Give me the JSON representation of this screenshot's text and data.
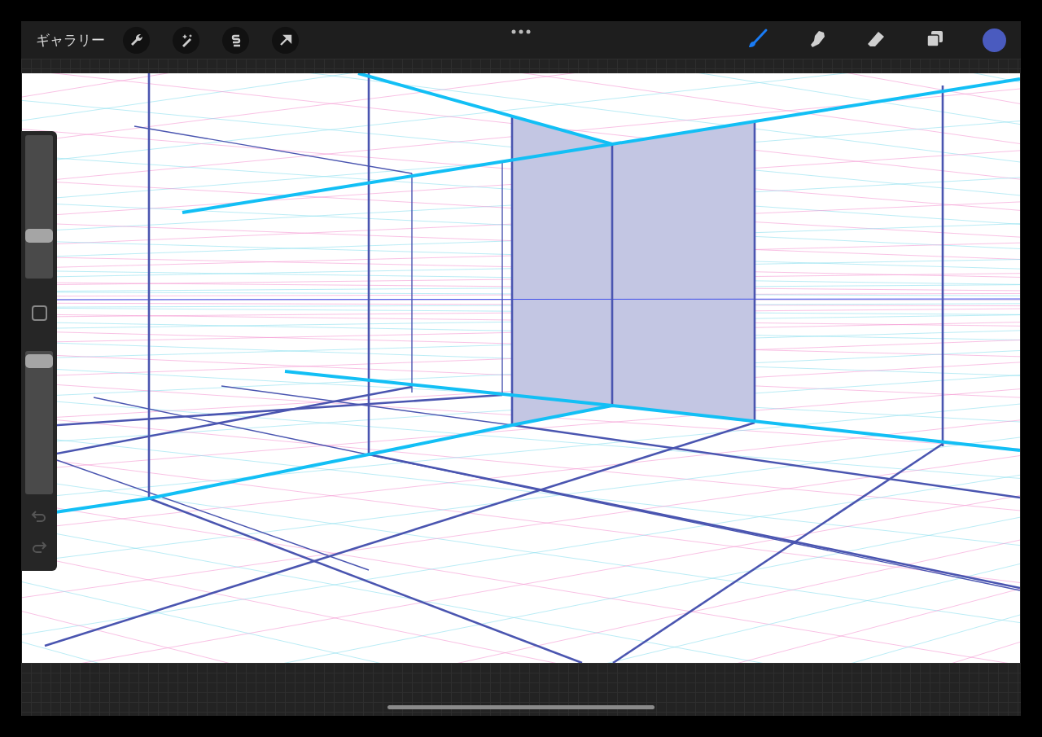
{
  "toolbar": {
    "gallery_label": "ギャラリー",
    "actions": [
      {
        "kind": "wrench"
      },
      {
        "kind": "wand"
      },
      {
        "kind": "selection"
      },
      {
        "kind": "transform"
      }
    ],
    "tools": [
      {
        "kind": "brush",
        "selected": true
      },
      {
        "kind": "smudge",
        "selected": false
      },
      {
        "kind": "eraser",
        "selected": false
      },
      {
        "kind": "layers",
        "selected": false
      }
    ],
    "color": "#4a5bbf"
  },
  "sidebar": {
    "sliders": [
      {
        "level": 0.3
      },
      {
        "level": 0.93
      }
    ],
    "undo": {
      "disabled": true
    },
    "redo": {
      "disabled": true
    }
  }
}
